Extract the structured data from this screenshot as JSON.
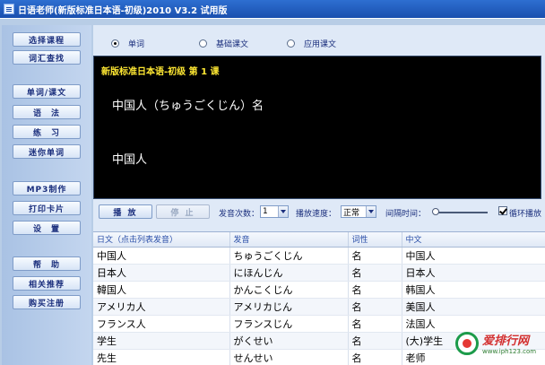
{
  "window": {
    "title": "日语老师(新版标准日本语-初级)2010 V3.2 试用版"
  },
  "nav": {
    "items": [
      "选择课程",
      "词汇查找",
      "单词/课文",
      "语　法",
      "练　习",
      "迷你单词",
      "MP3制作",
      "打印卡片",
      "设　置",
      "帮　助",
      "相关推荐",
      "购买注册"
    ]
  },
  "modes": [
    {
      "label": "单词",
      "selected": true
    },
    {
      "label": "基础课文",
      "selected": false
    },
    {
      "label": "应用课文",
      "selected": false
    }
  ],
  "display": {
    "lesson_title": "新版标准日本语-初级 第 1 课",
    "reading": "中国人（ちゅうごくじん）名",
    "meaning": "中国人"
  },
  "controls": {
    "play_label": "播 放",
    "stop_label": "停 止",
    "repeat_label": "发音次数：",
    "repeat_value": "1",
    "speed_label": "播放速度：",
    "speed_value": "正常",
    "interval_label": "间隔时间：",
    "loop_label": "循环播放",
    "loop_checked": true
  },
  "table": {
    "headers": [
      "日文（点击列表发音）",
      "发音",
      "词性",
      "中文"
    ],
    "rows": [
      [
        "中国人",
        "ちゅうごくじん",
        "名",
        "中国人"
      ],
      [
        "日本人",
        "にほんじん",
        "名",
        "日本人"
      ],
      [
        "韓国人",
        "かんこくじん",
        "名",
        "韩国人"
      ],
      [
        "アメリカ人",
        "アメリカじん",
        "名",
        "美国人"
      ],
      [
        "フランス人",
        "フランスじん",
        "名",
        "法国人"
      ],
      [
        "学生",
        "がくせい",
        "名",
        "(大)学生"
      ],
      [
        "先生",
        "せんせい",
        "名",
        "老师"
      ]
    ]
  },
  "watermark": {
    "text": "爱排行网",
    "url": "www.iph123.com"
  },
  "colors": {
    "title_bar": "#1a4fae",
    "lesson_title": "#ffe833",
    "display_bg": "#000000",
    "accent": "#1b2f7d"
  }
}
